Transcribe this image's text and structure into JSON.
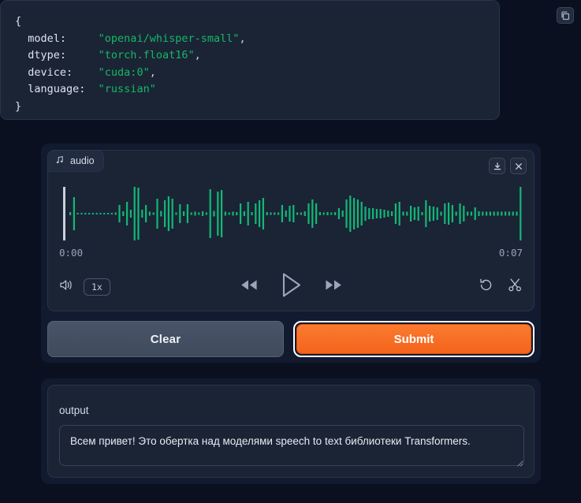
{
  "code_block": {
    "copy_icon": "copy-icon",
    "lines": [
      {
        "indent": 0,
        "text": "{",
        "type": "brace"
      },
      {
        "indent": 1,
        "key": "model:",
        "value": "\"openai/whisper-small\"",
        "comma": ","
      },
      {
        "indent": 1,
        "key": "dtype:",
        "value": "\"torch.float16\"",
        "comma": ","
      },
      {
        "indent": 1,
        "key": "device:",
        "value": "\"cuda:0\"",
        "comma": ","
      },
      {
        "indent": 1,
        "key": "language:",
        "value": "\"russian\"",
        "comma": ""
      },
      {
        "indent": 0,
        "text": "}",
        "type": "brace"
      }
    ],
    "raw": "{\n  model:    \"openai/whisper-small\",\n  dtype:    \"torch.float16\",\n  device:   \"cuda:0\",\n  language: \"russian\"\n}"
  },
  "audio_player": {
    "tab_label": "audio",
    "tab_icon": "music-note-icon",
    "download_icon": "download-icon",
    "close_icon": "close-icon",
    "time_current": "0:00",
    "time_total": "0:07",
    "volume_icon": "volume-icon",
    "speed_label": "1x",
    "rewind_icon": "rewind-icon",
    "play_icon": "play-icon",
    "forward_icon": "fast-forward-icon",
    "undo_icon": "undo-icon",
    "trim_icon": "scissors-icon",
    "waveform_color": "#11b877",
    "cursor_color": "#c9cfdd",
    "waveform": [
      4,
      42,
      2,
      2,
      2,
      2,
      2,
      2,
      2,
      2,
      2,
      2,
      3,
      22,
      6,
      30,
      10,
      68,
      66,
      10,
      22,
      5,
      3,
      38,
      7,
      34,
      44,
      38,
      3,
      24,
      6,
      24,
      3,
      5,
      3,
      6,
      3,
      62,
      7,
      56,
      60,
      5,
      3,
      5,
      4,
      26,
      6,
      30,
      4,
      26,
      34,
      40,
      4,
      3,
      3,
      3,
      22,
      8,
      20,
      22,
      3,
      3,
      6,
      26,
      36,
      26,
      4,
      3,
      4,
      3,
      4,
      14,
      8,
      36,
      46,
      40,
      36,
      30,
      18,
      14,
      14,
      12,
      12,
      10,
      8,
      6,
      26,
      30,
      5,
      5,
      20,
      16,
      18,
      4,
      34,
      20,
      18,
      16,
      5,
      26,
      28,
      22,
      5,
      26,
      20,
      5,
      5,
      16,
      6,
      5,
      5,
      5,
      5,
      5,
      5,
      5,
      5,
      5,
      5,
      68
    ]
  },
  "actions": {
    "clear_label": "Clear",
    "submit_label": "Submit",
    "submit_color": "#f4631b",
    "clear_color": "#454f62"
  },
  "output": {
    "label": "output",
    "value": "Всем привет! Это обертка над моделями speech to text библиотеки Transformers.",
    "resize_handle": "resize-grip-icon"
  }
}
